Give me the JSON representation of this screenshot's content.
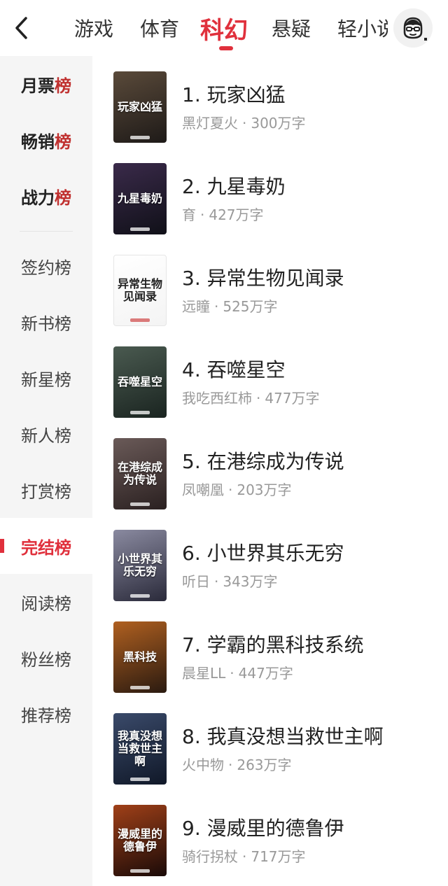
{
  "tabs": [
    {
      "label": "游戏",
      "active": false
    },
    {
      "label": "体育",
      "active": false
    },
    {
      "label": "科幻",
      "active": true
    },
    {
      "label": "悬疑",
      "active": false
    },
    {
      "label": "轻小说",
      "active": false
    }
  ],
  "sidebar": [
    {
      "label": "月票",
      "suffix": "榜",
      "style": "bold"
    },
    {
      "label": "畅销",
      "suffix": "榜",
      "style": "bold"
    },
    {
      "label": "战力",
      "suffix": "榜",
      "style": "bold"
    },
    {
      "label": "签约榜",
      "suffix": "",
      "style": "normal"
    },
    {
      "label": "新书榜",
      "suffix": "",
      "style": "normal"
    },
    {
      "label": "新星榜",
      "suffix": "",
      "style": "normal"
    },
    {
      "label": "新人榜",
      "suffix": "",
      "style": "normal"
    },
    {
      "label": "打赏榜",
      "suffix": "",
      "style": "normal"
    },
    {
      "label": "完结榜",
      "suffix": "",
      "style": "active"
    },
    {
      "label": "阅读榜",
      "suffix": "",
      "style": "normal"
    },
    {
      "label": "粉丝榜",
      "suffix": "",
      "style": "normal"
    },
    {
      "label": "推荐榜",
      "suffix": "",
      "style": "normal"
    }
  ],
  "books": [
    {
      "rank": "1.",
      "title": "玩家凶猛",
      "author": "黑灯夏火",
      "words": "300万字",
      "cover_text": "玩家凶猛",
      "cover_colors": [
        "#5a4a3a",
        "#1e1a18"
      ]
    },
    {
      "rank": "2.",
      "title": "九星毒奶",
      "author": "育",
      "words": "427万字",
      "cover_text": "九星毒奶",
      "cover_colors": [
        "#3a2a4a",
        "#101018"
      ]
    },
    {
      "rank": "3.",
      "title": "异常生物见闻录",
      "author": "远瞳",
      "words": "525万字",
      "cover_text": "异常生物见闻录",
      "cover_colors": [
        "#ffffff",
        "#f4f4f4"
      ]
    },
    {
      "rank": "4.",
      "title": "吞噬星空",
      "author": "我吃西红柿",
      "words": "477万字",
      "cover_text": "吞噬星空",
      "cover_colors": [
        "#4a5a50",
        "#1a2420"
      ]
    },
    {
      "rank": "5.",
      "title": "在港综成为传说",
      "author": "凤嘲凰",
      "words": "203万字",
      "cover_text": "在港综成为传说",
      "cover_colors": [
        "#6a5a58",
        "#2a2020"
      ]
    },
    {
      "rank": "6.",
      "title": "小世界其乐无穷",
      "author": "听日",
      "words": "343万字",
      "cover_text": "小世界其乐无穷",
      "cover_colors": [
        "#8a8aa0",
        "#2a2a3a"
      ]
    },
    {
      "rank": "7.",
      "title": "学霸的黑科技系统",
      "author": "晨星LL",
      "words": "447万字",
      "cover_text": "黑科技",
      "cover_colors": [
        "#b06020",
        "#2a1a10"
      ]
    },
    {
      "rank": "8.",
      "title": "我真没想当救世主啊",
      "author": "火中物",
      "words": "263万字",
      "cover_text": "我真没想当救世主啊",
      "cover_colors": [
        "#3a4a6a",
        "#101828"
      ]
    },
    {
      "rank": "9.",
      "title": "漫威里的德鲁伊",
      "author": "骑行拐杖",
      "words": "717万字",
      "cover_text": "漫威里的德鲁伊",
      "cover_colors": [
        "#a04018",
        "#1a0a08"
      ]
    }
  ]
}
